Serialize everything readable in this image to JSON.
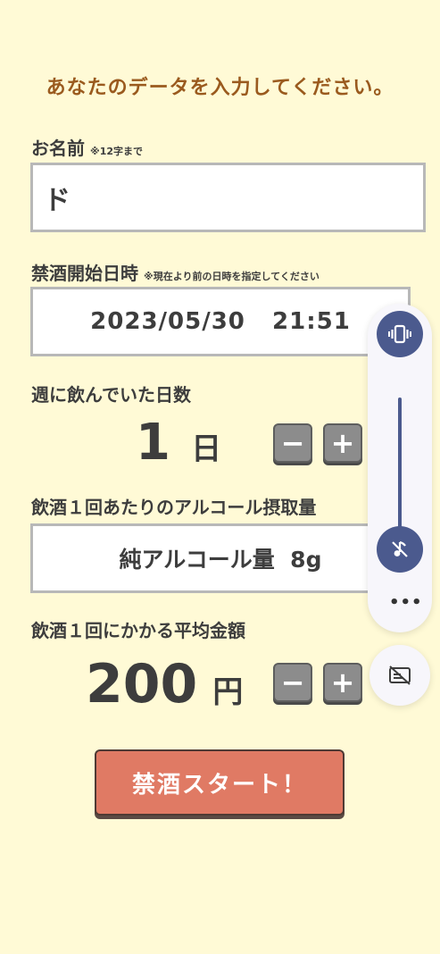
{
  "heading": "あなたのデータを入力してください。",
  "name": {
    "label": "お名前",
    "note": "※12字まで",
    "value": "ド"
  },
  "start_datetime": {
    "label": "禁酒開始日時",
    "note": "※現在より前の日時を指定してください",
    "value": "2023/05/30   21:51"
  },
  "drink_days": {
    "label": "週に飲んでいた日数",
    "value": "1",
    "unit": "日",
    "minus": "−",
    "plus": "+"
  },
  "alcohol": {
    "label": "飲酒１回あたりのアルコール摂取量",
    "value": "純アルコール量  8g"
  },
  "cost": {
    "label": "飲酒１回にかかる平均金額",
    "value": "200",
    "unit": "円",
    "minus": "−",
    "plus": "+"
  },
  "start_button": "禁酒スタート！",
  "volume_overlay": {
    "more": "•••",
    "icons": [
      "vibrate-icon",
      "mute-icon",
      "captions-off-icon"
    ],
    "accent": "#4b5a8e"
  }
}
